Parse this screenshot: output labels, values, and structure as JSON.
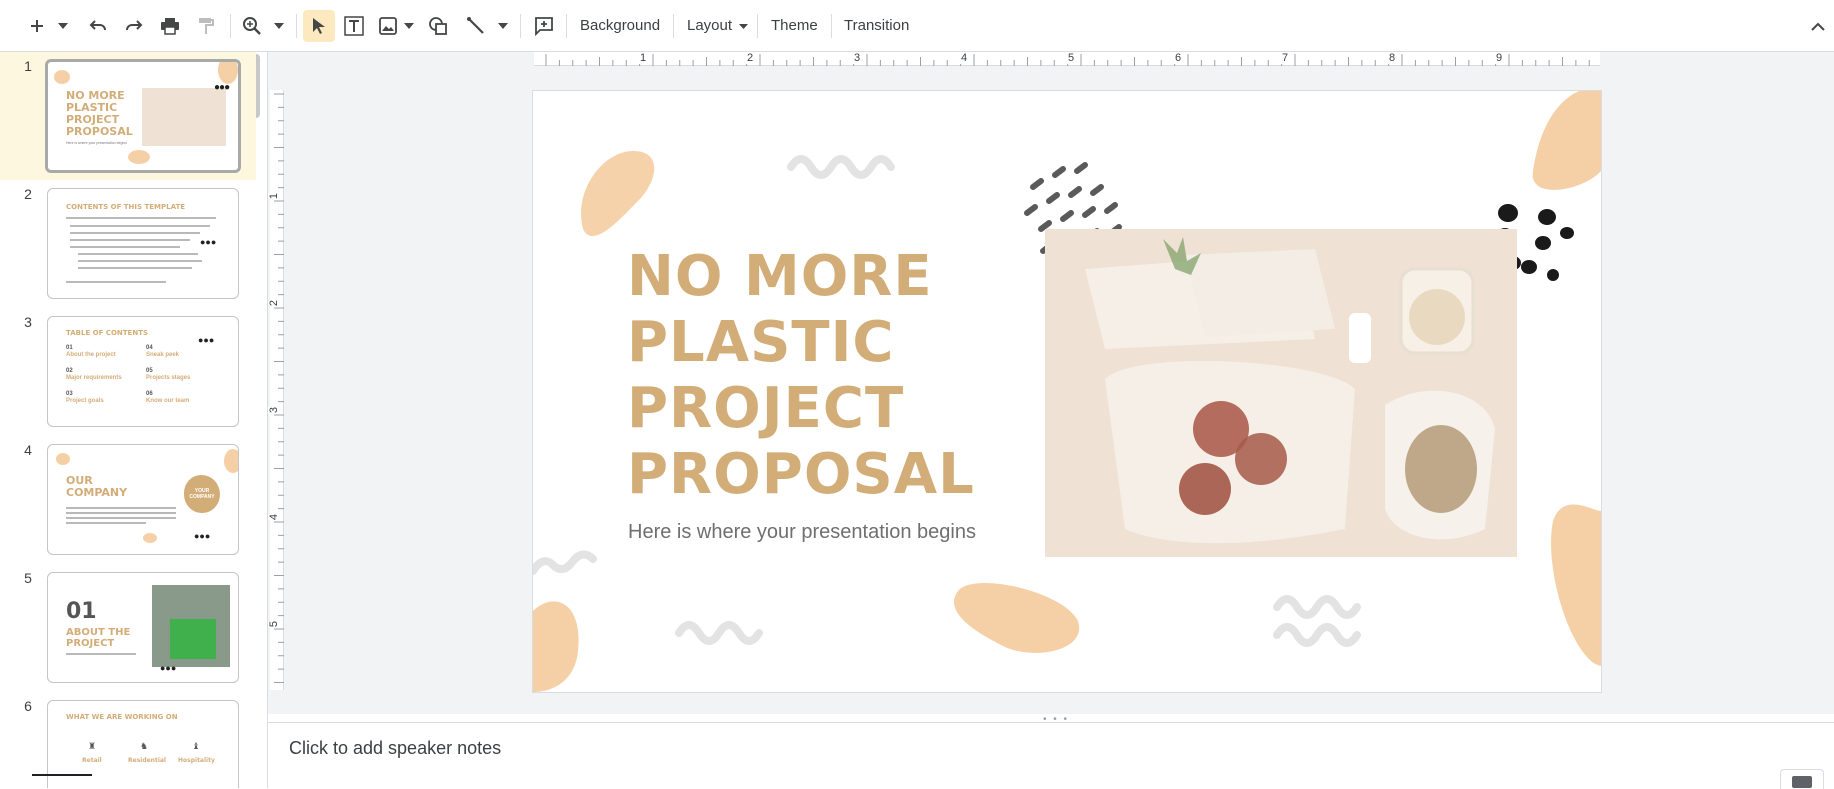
{
  "toolbar": {
    "background_label": "Background",
    "layout_label": "Layout",
    "theme_label": "Theme",
    "transition_label": "Transition"
  },
  "filmstrip": {
    "slides": [
      {
        "number": "1",
        "title": "NO MORE PLASTIC PROJECT PROPOSAL",
        "subtitle": "Here is where your presentation begins"
      },
      {
        "number": "2",
        "title": "CONTENTS OF THIS TEMPLATE"
      },
      {
        "number": "3",
        "title": "TABLE OF CONTENTS",
        "items": [
          {
            "num": "01",
            "label": "About the project"
          },
          {
            "num": "02",
            "label": "Major requirements"
          },
          {
            "num": "03",
            "label": "Project goals"
          },
          {
            "num": "04",
            "label": "Sneak peek"
          },
          {
            "num": "05",
            "label": "Projects stages"
          },
          {
            "num": "06",
            "label": "Know our team"
          }
        ]
      },
      {
        "number": "4",
        "title": "OUR COMPANY",
        "badge": "YOUR COMPANY"
      },
      {
        "number": "5",
        "title_num": "01",
        "title": "ABOUT THE PROJECT"
      },
      {
        "number": "6",
        "title": "WHAT WE ARE WORKING ON",
        "columns": [
          "Retail",
          "Residential",
          "Hospitality"
        ]
      }
    ]
  },
  "ruler": {
    "h_labels": [
      "1",
      "2",
      "3",
      "4",
      "5",
      "6",
      "7",
      "8",
      "9"
    ],
    "v_labels": [
      "1",
      "2",
      "3",
      "4",
      "5"
    ]
  },
  "slide": {
    "title": "NO MORE\nPLASTIC\nPROJECT\nPROPOSAL",
    "subtitle": "Here is where your presentation begins"
  },
  "notes": {
    "placeholder": "Click to add speaker notes"
  },
  "colors": {
    "accent": "#d3ad78",
    "blob": "#f5d0a6",
    "selected_tool": "#fde9bf"
  }
}
